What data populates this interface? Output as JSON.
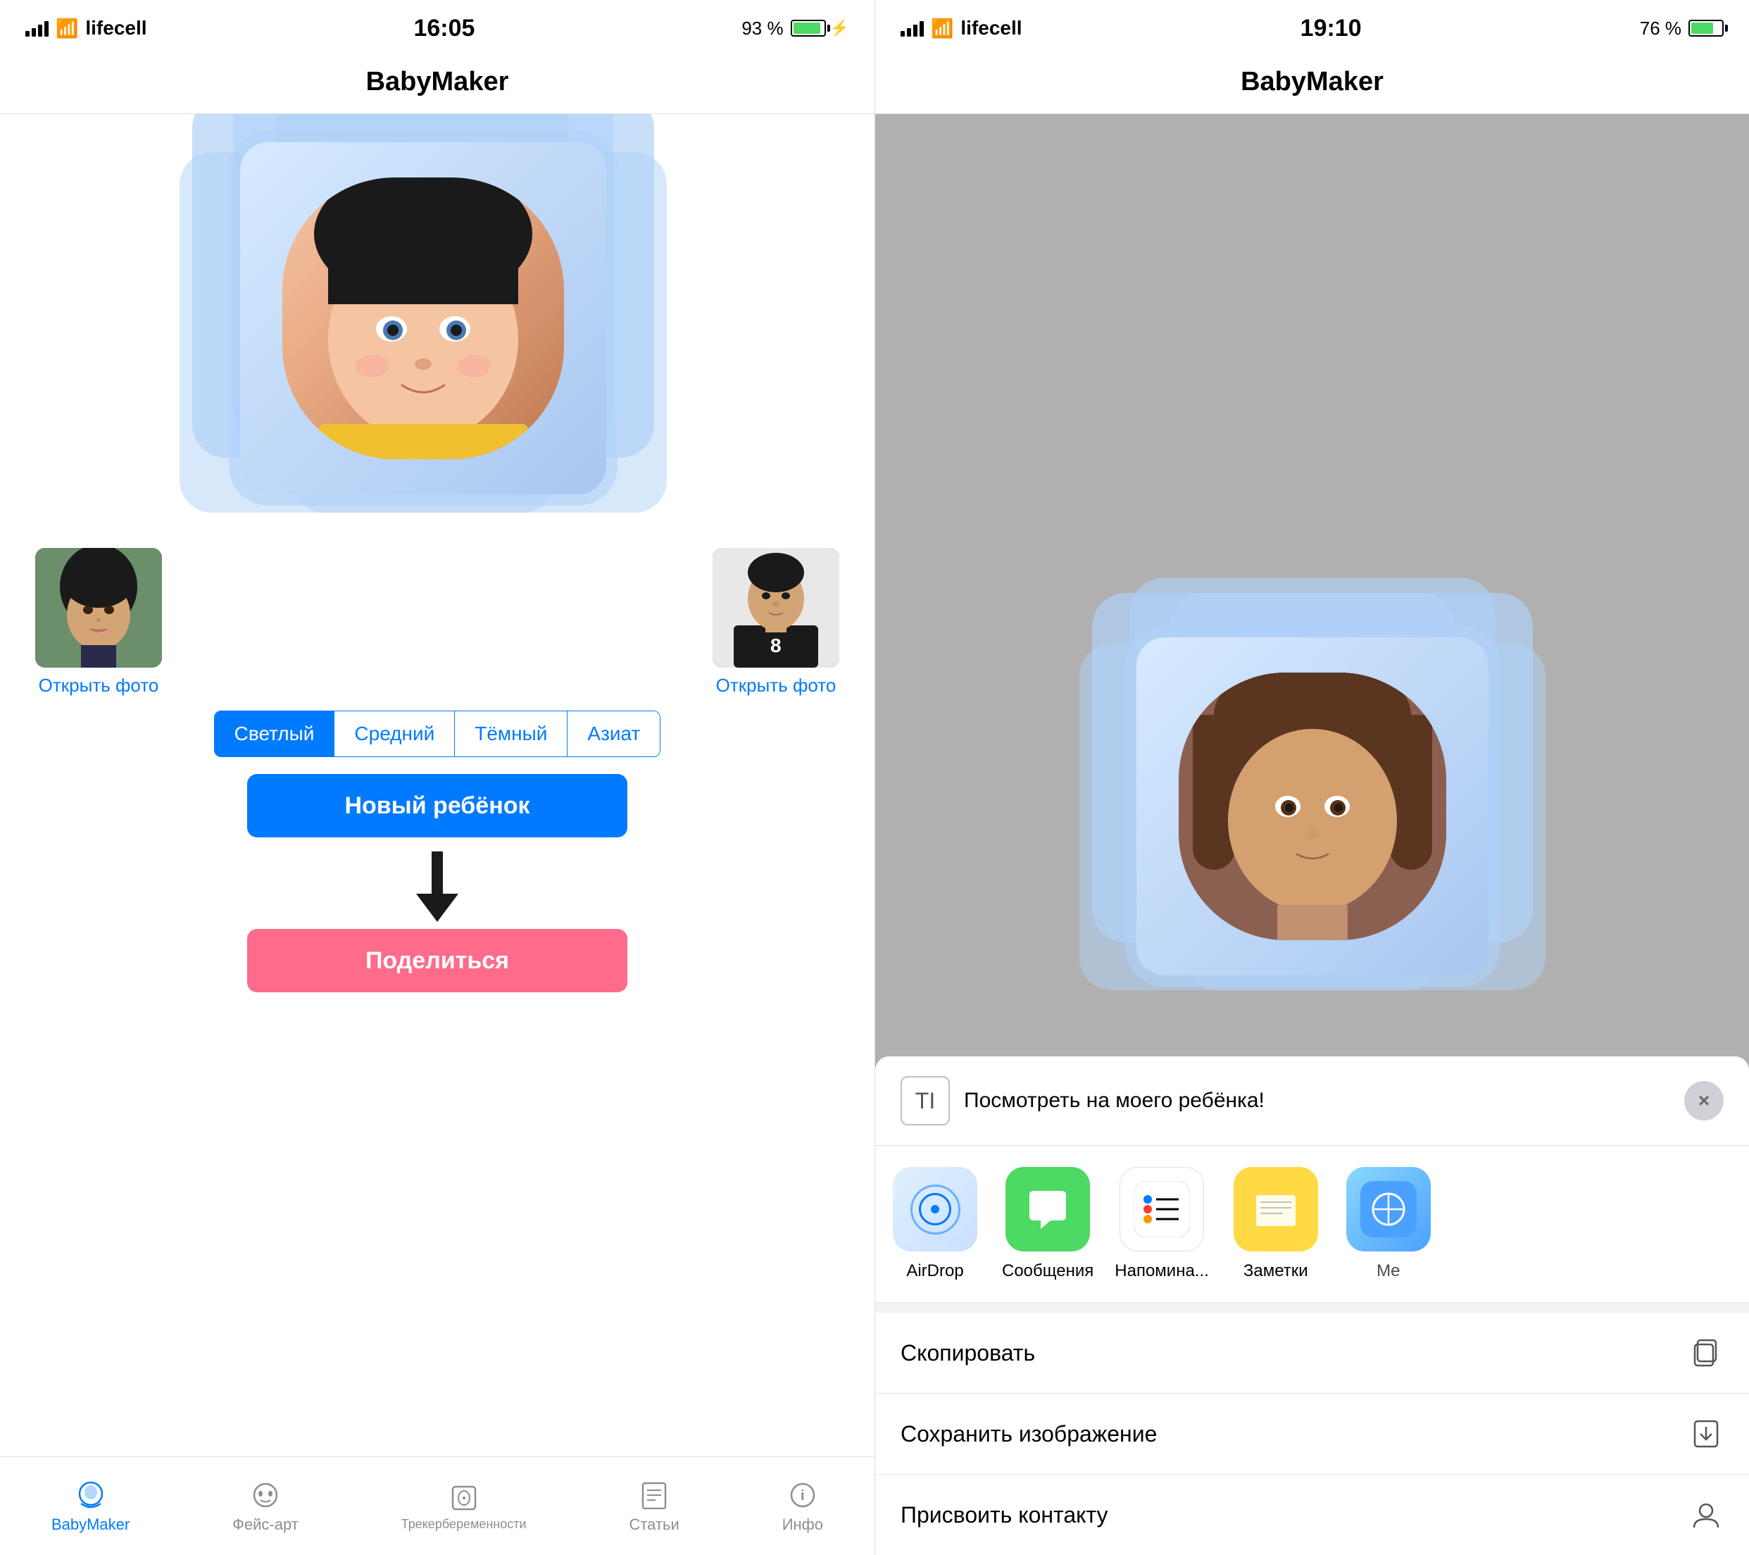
{
  "left": {
    "statusBar": {
      "carrier": "lifecell",
      "time": "16:05",
      "battery": "93 %",
      "batteryPercent": 93,
      "charging": true
    },
    "navTitle": "BabyMaker",
    "skinButtons": [
      {
        "label": "Светлый",
        "active": true
      },
      {
        "label": "Средний",
        "active": false
      },
      {
        "label": "Тёмный",
        "active": false
      },
      {
        "label": "Азиат",
        "active": false
      }
    ],
    "openPhotoLeft": "Открыть фото",
    "openPhotoRight": "Открыть фото",
    "newBabyBtn": "Новый ребёнок",
    "shareBtn": "Поделиться",
    "tabBar": [
      {
        "label": "BabyMaker",
        "active": true
      },
      {
        "label": "Фейс-арт",
        "active": false
      },
      {
        "label": "Трекербеременности",
        "active": false
      },
      {
        "label": "Статьи",
        "active": false
      },
      {
        "label": "Инфо",
        "active": false
      }
    ]
  },
  "right": {
    "statusBar": {
      "carrier": "lifecell",
      "time": "19:10",
      "battery": "76 %",
      "batteryPercent": 76,
      "charging": false
    },
    "navTitle": "BabyMaker",
    "shareSheet": {
      "messageText": "Посмотреть на моего ребёнка!",
      "textIconLabel": "TI",
      "closeBtn": "×",
      "apps": [
        {
          "label": "AirDrop",
          "type": "airdrop"
        },
        {
          "label": "Сообщения",
          "type": "messages"
        },
        {
          "label": "Напомина...",
          "type": "reminders"
        },
        {
          "label": "Заметки",
          "type": "notes"
        },
        {
          "label": "Me",
          "type": "more"
        }
      ],
      "actions": [
        {
          "label": "Скопировать",
          "iconType": "copy"
        },
        {
          "label": "Сохранить изображение",
          "iconType": "save"
        },
        {
          "label": "Присвоить контакту",
          "iconType": "contact"
        }
      ]
    }
  }
}
